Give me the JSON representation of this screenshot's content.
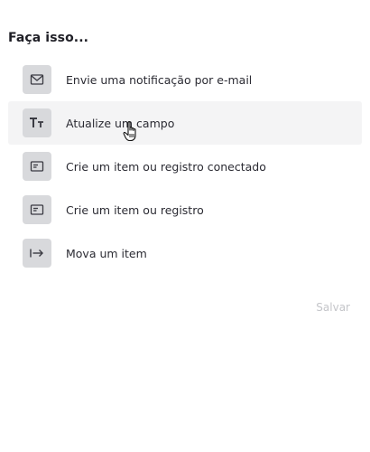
{
  "heading": "Faça isso...",
  "actions": [
    {
      "label": "Envie uma notificação por e-mail",
      "icon": "mail-icon"
    },
    {
      "label": "Atualize um campo",
      "icon": "text-size-icon"
    },
    {
      "label": "Crie um item ou registro conectado",
      "icon": "card-icon"
    },
    {
      "label": "Crie um item ou registro",
      "icon": "card-icon"
    },
    {
      "label": "Mova um item",
      "icon": "arrow-right-to-bar-icon"
    }
  ],
  "save_label": "Salvar",
  "colors": {
    "icon_bg": "#d8d9dc",
    "hover_bg": "#f4f4f5",
    "text": "#2b2b33",
    "disabled_text": "#c4c5c9"
  }
}
